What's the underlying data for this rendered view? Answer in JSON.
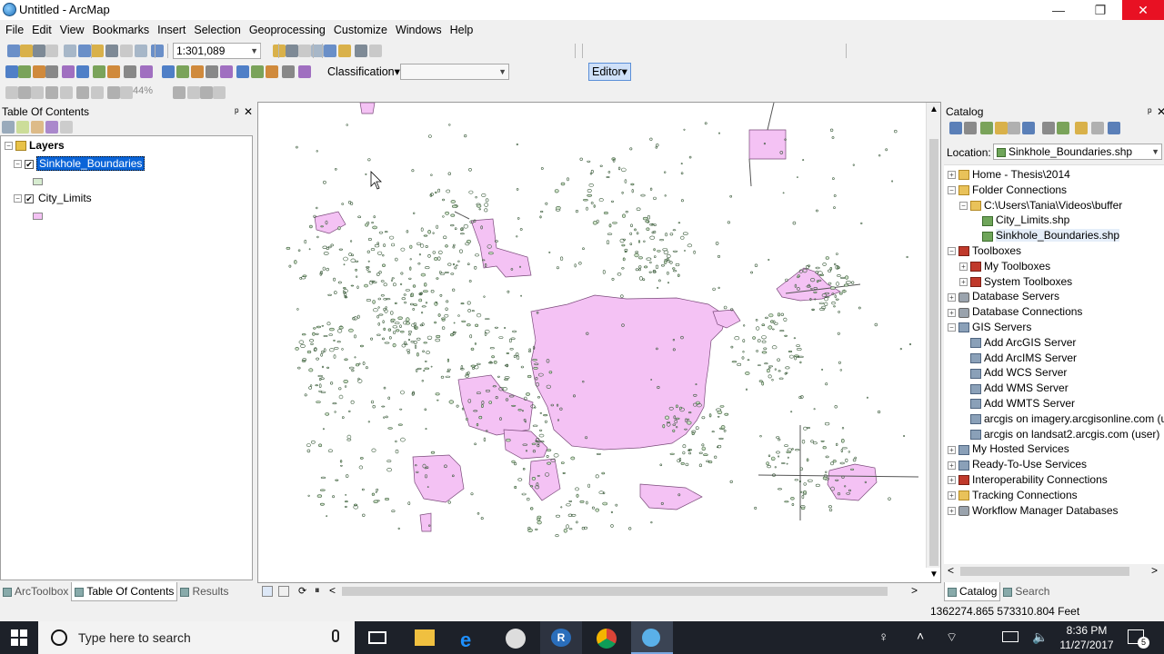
{
  "window": {
    "title": "Untitled - ArcMap",
    "controls": [
      "—",
      "❐",
      "✕"
    ]
  },
  "menu": [
    "File",
    "Edit",
    "View",
    "Bookmarks",
    "Insert",
    "Selection",
    "Geoprocessing",
    "Customize",
    "Windows",
    "Help"
  ],
  "toolbar": {
    "scale": "1:301,089",
    "classification_label": "Classification",
    "editor_label": "Editor",
    "zoom_level": "44%"
  },
  "toc": {
    "title": "Table Of Contents",
    "root": "Layers",
    "layers": [
      {
        "name": "Sinkhole_Boundaries",
        "checked": true,
        "selected": true,
        "symbol_color": "#d7ecd0"
      },
      {
        "name": "City_Limits",
        "checked": true,
        "selected": false,
        "symbol_color": "#f4c2f4"
      }
    ],
    "tabs": [
      "ArcToolbox",
      "Table Of Contents",
      "Results"
    ],
    "active_tab": "Table Of Contents"
  },
  "catalog": {
    "title": "Catalog",
    "location_label": "Location:",
    "location_value": "Sinkhole_Boundaries.shp",
    "items": [
      {
        "label": "Home - Thesis\\2014",
        "indent": 0,
        "exp": "+",
        "icon": "folder"
      },
      {
        "label": "Folder Connections",
        "indent": 0,
        "exp": "−",
        "icon": "folder"
      },
      {
        "label": "C:\\Users\\Tania\\Videos\\buffer",
        "indent": 1,
        "exp": "−",
        "icon": "folder"
      },
      {
        "label": "City_Limits.shp",
        "indent": 2,
        "exp": "",
        "icon": "shp"
      },
      {
        "label": "Sinkhole_Boundaries.shp",
        "indent": 2,
        "exp": "",
        "icon": "shp",
        "selected": true
      },
      {
        "label": "Toolboxes",
        "indent": 0,
        "exp": "−",
        "icon": "toolbox"
      },
      {
        "label": "My Toolboxes",
        "indent": 1,
        "exp": "+",
        "icon": "toolbox"
      },
      {
        "label": "System Toolboxes",
        "indent": 1,
        "exp": "+",
        "icon": "toolbox"
      },
      {
        "label": "Database Servers",
        "indent": 0,
        "exp": "+",
        "icon": "db"
      },
      {
        "label": "Database Connections",
        "indent": 0,
        "exp": "+",
        "icon": "db"
      },
      {
        "label": "GIS Servers",
        "indent": 0,
        "exp": "−",
        "icon": "server"
      },
      {
        "label": "Add ArcGIS Server",
        "indent": 1,
        "exp": "",
        "icon": "server"
      },
      {
        "label": "Add ArcIMS Server",
        "indent": 1,
        "exp": "",
        "icon": "server"
      },
      {
        "label": "Add WCS Server",
        "indent": 1,
        "exp": "",
        "icon": "server"
      },
      {
        "label": "Add WMS Server",
        "indent": 1,
        "exp": "",
        "icon": "server"
      },
      {
        "label": "Add WMTS Server",
        "indent": 1,
        "exp": "",
        "icon": "server"
      },
      {
        "label": "arcgis on imagery.arcgisonline.com (u",
        "indent": 1,
        "exp": "",
        "icon": "server"
      },
      {
        "label": "arcgis on landsat2.arcgis.com (user)",
        "indent": 1,
        "exp": "",
        "icon": "server"
      },
      {
        "label": "My Hosted Services",
        "indent": 0,
        "exp": "+",
        "icon": "server"
      },
      {
        "label": "Ready-To-Use Services",
        "indent": 0,
        "exp": "+",
        "icon": "server"
      },
      {
        "label": "Interoperability Connections",
        "indent": 0,
        "exp": "+",
        "icon": "toolbox"
      },
      {
        "label": "Tracking Connections",
        "indent": 0,
        "exp": "+",
        "icon": "folder"
      },
      {
        "label": "Workflow Manager Databases",
        "indent": 0,
        "exp": "+",
        "icon": "db"
      }
    ],
    "tabs": [
      "Catalog",
      "Search"
    ],
    "active_tab": "Catalog"
  },
  "status": {
    "coordinates": "1362274.865  573310.804 Feet"
  },
  "taskbar": {
    "search_placeholder": "Type here to search",
    "time": "8:36 PM",
    "date": "11/27/2017",
    "notification_count": "5"
  },
  "colors": {
    "city_fill": "#f4c2f4",
    "city_stroke": "#7a4a7a",
    "sinkhole_stroke": "#3a5a3a",
    "selection": "#0a64d8"
  }
}
